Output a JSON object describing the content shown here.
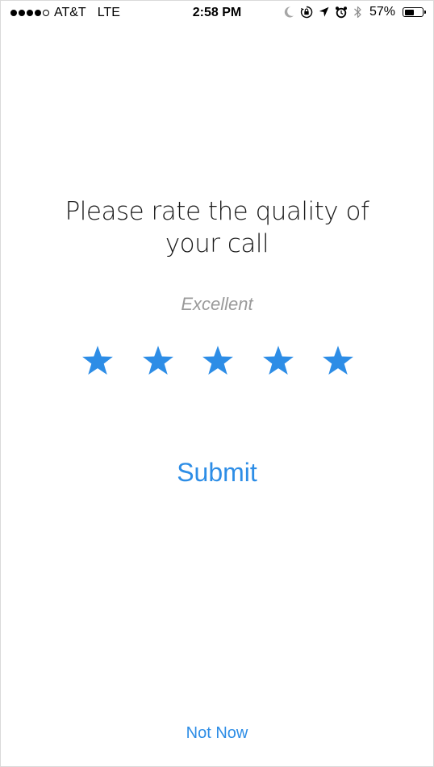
{
  "status_bar": {
    "carrier": "AT&T",
    "network": "LTE",
    "signal_bars_filled": 4,
    "signal_bars_total": 5,
    "time": "2:58 PM",
    "battery_percent": "57%",
    "battery_level": 0.57,
    "icons": [
      "moon-icon",
      "rotation-lock-icon",
      "location-arrow-icon",
      "alarm-clock-icon",
      "bluetooth-icon"
    ]
  },
  "rating_prompt": {
    "title": "Please rate the quality of your call",
    "selected_label": "Excellent",
    "rating": 5,
    "max_rating": 5,
    "star_color": "#2d8de6",
    "submit_label": "Submit",
    "not_now_label": "Not Now"
  },
  "colors": {
    "accent": "#2d8de6",
    "label_gray": "#9a9a9a"
  }
}
